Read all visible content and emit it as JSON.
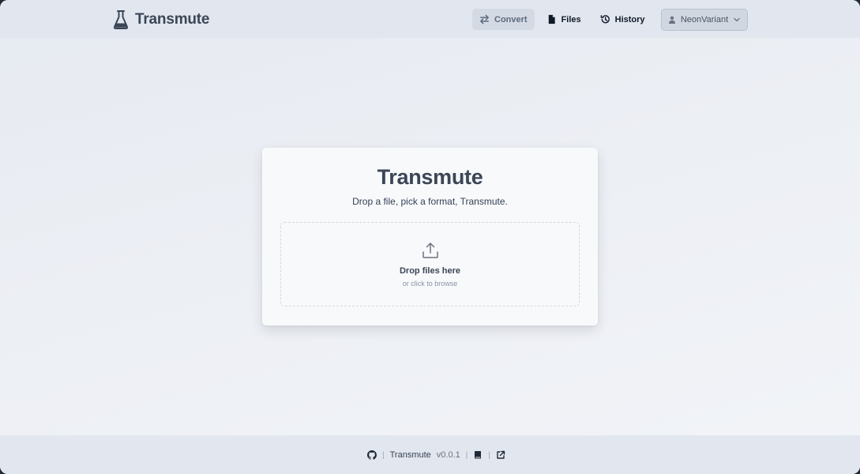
{
  "header": {
    "brand": "Transmute",
    "brand_icon": "flask-icon",
    "nav": [
      {
        "label": "Convert",
        "icon": "swap-arrows-icon",
        "active": true
      },
      {
        "label": "Files",
        "icon": "file-icon",
        "active": false
      },
      {
        "label": "History",
        "icon": "history-icon",
        "active": false
      }
    ],
    "user": {
      "label": "NeonVariant",
      "icon": "user-icon"
    }
  },
  "card": {
    "title": "Transmute",
    "subtitle": "Drop a file, pick a format, Transmute.",
    "dropzone": {
      "icon": "upload-icon",
      "title": "Drop files here",
      "subtitle": "or click to browse"
    }
  },
  "footer": {
    "app_name": "Transmute",
    "version": "v0.0.1",
    "separator": "|",
    "icons": [
      "github-icon",
      "book-icon",
      "external-link-icon"
    ]
  },
  "colors": {
    "header_bg": "#e2e7ef",
    "page_bg": "#eceff4",
    "card_bg": "#f8f9fb",
    "title": "#3b4656"
  }
}
